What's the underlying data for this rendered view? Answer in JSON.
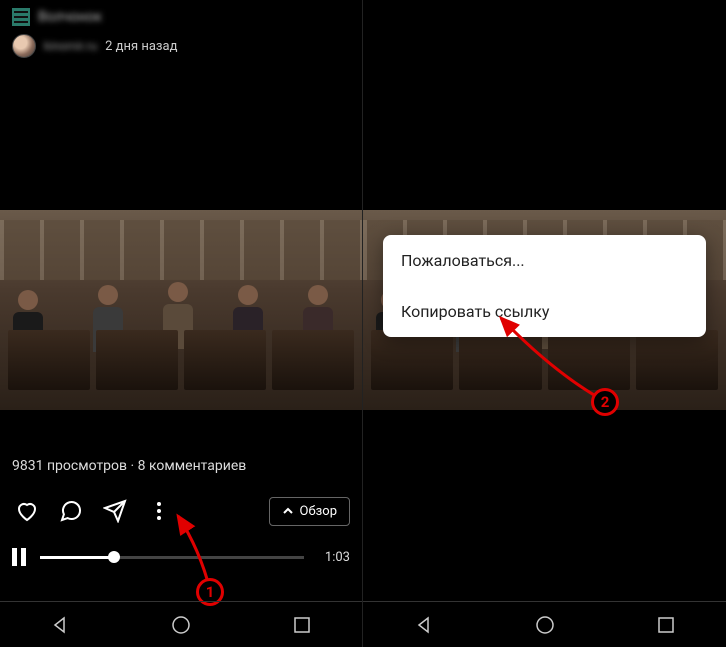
{
  "header": {
    "title": "Волчонок",
    "username": "kinomir.ru",
    "timestamp": "2 дня назад"
  },
  "stats": {
    "views_count": 9831,
    "views_label": "просмотров",
    "comments_count": 8,
    "comments_label": "комментариев",
    "separator": " · "
  },
  "actions": {
    "overview_label": "Обзор"
  },
  "progress": {
    "current_time": "1:03",
    "percent": 28
  },
  "popup": {
    "items": [
      {
        "label": "Пожаловаться..."
      },
      {
        "label": "Копировать ссылку"
      }
    ]
  },
  "annotations": {
    "marker1": "1",
    "marker2": "2"
  },
  "colors": {
    "accent_red": "#e00000"
  }
}
